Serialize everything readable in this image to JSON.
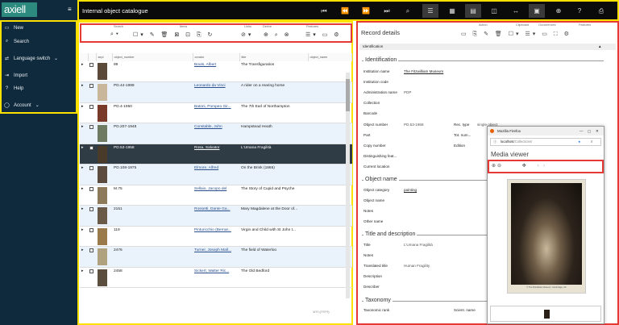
{
  "app": {
    "logo": "axiell",
    "title": "Internal object catalogue"
  },
  "sidebar": {
    "items": [
      {
        "label": "New",
        "icon": "file-icon"
      },
      {
        "label": "Search",
        "icon": "search-icon"
      },
      {
        "label": "Language switch",
        "icon": "language-icon"
      },
      {
        "label": "Import",
        "icon": "import-icon"
      },
      {
        "label": "Help",
        "icon": "help-icon"
      },
      {
        "label": "Account",
        "icon": "account-icon"
      }
    ]
  },
  "toolbar": {
    "groups": [
      "Search",
      "Items",
      "Links",
      "Derive",
      "Features"
    ]
  },
  "table": {
    "headers": [
      "sepi",
      "object_number",
      "creator",
      "title",
      "object_name"
    ],
    "rows": [
      {
        "num": "99",
        "creator": "Bouts, Albert",
        "title": "The Transfiguration"
      },
      {
        "num": "PD.44-1999",
        "creator": "Leonardo da Vinci",
        "title": "A rider on a rearing horse"
      },
      {
        "num": "PD.4-1950",
        "creator": "Batoni, Pompeo Gir...",
        "title": "The 7th Earl of Northampton"
      },
      {
        "num": "PD.207-1948",
        "creator": "Constable, John",
        "title": "Hampstead Heath"
      },
      {
        "num": "PD.53-1958",
        "creator": "Rosa, Salvator",
        "title": "L'Umana Fragilità"
      },
      {
        "num": "PD.108-1975",
        "creator": "Elmore, Alfred",
        "title": "On the Brink (1865)"
      },
      {
        "num": "M.75",
        "creator": "Sellaio, Jacopo del",
        "title": "The Story of Cupid and Psyche"
      },
      {
        "num": "2151",
        "creator": "Rossetti, Dante Ga...",
        "title": "Mary Magdalene at the Door of..."
      },
      {
        "num": "119",
        "creator": "Pinturicchio (Bernar...",
        "title": "Virgin and Child with St John t..."
      },
      {
        "num": "2476",
        "creator": "Turner, Joseph Mall...",
        "title": "The field of Waterloo"
      },
      {
        "num": "2458",
        "creator": "Sickert, Walter Ric...",
        "title": "The Old Bedford"
      }
    ],
    "footer": "1/?? (??/??)"
  },
  "record": {
    "title": "Record details",
    "groups": [
      "Action",
      "Clipboard",
      "Occurrences",
      "Features"
    ],
    "identification_bar": "Identification",
    "identification": {
      "heading": "Identification",
      "institution_name_label": "Institution name",
      "institution_name": "The Fitzwilliam Museum",
      "institution_code_label": "Institution code",
      "admin_name_label": "Administration name",
      "admin_name": "PDP",
      "collection_label": "Collection",
      "barcode_label": "Barcode",
      "object_number_label": "Object number",
      "object_number": "PD.53-1958",
      "rec_type_label": "Rec. type",
      "rec_type": "single object",
      "part_label": "Part",
      "tot_num_label": "Tot. num...",
      "copy_number_label": "Copy number",
      "edition_label": "Edition",
      "distinguishing_label": "Distinguishing feat...",
      "current_location_label": "Current location"
    },
    "object_name": {
      "heading": "Object name",
      "category_label": "Object category",
      "category": "painting",
      "object_name_label": "Object name",
      "notes_label": "Notes",
      "other_name_label": "Other name"
    },
    "title_desc": {
      "heading": "Title and description",
      "title_label": "Title",
      "title": "L'Umana Fragilità",
      "notes_label": "Notes",
      "translated_label": "Translated title",
      "translated": "Human Fragility",
      "description_label": "Description",
      "describer_label": "Describer"
    },
    "taxonomy": {
      "heading": "Taxonomy",
      "rank_label": "Taxonomic rank",
      "scient_label": "Scient. name"
    }
  },
  "popup": {
    "window_title": "Mozilla Firefox",
    "url_host": "localhost",
    "url_path": "/Collections/",
    "heading": "Media viewer",
    "caption": "© The Fitzwilliam Museum, Cambridge, UK"
  },
  "colors": {
    "highlight_yellow": "#ffe100",
    "highlight_red": "#e53935",
    "sidebar": "#0f2a3d",
    "logo": "#2d8a7f"
  }
}
